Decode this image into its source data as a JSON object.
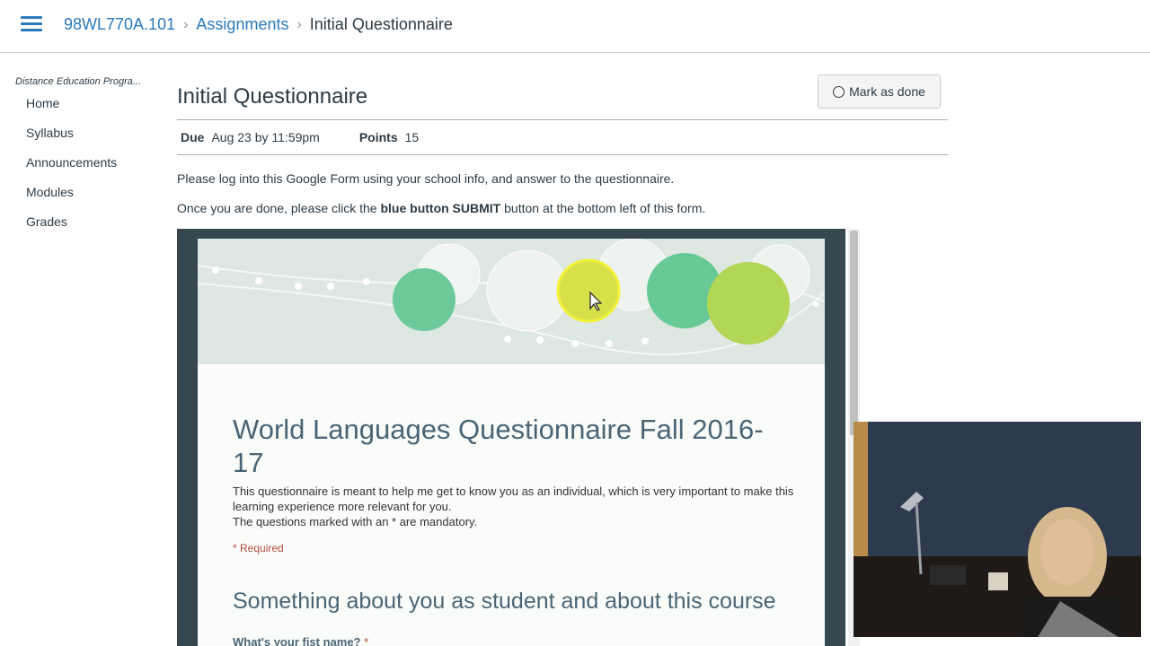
{
  "header": {
    "breadcrumbs": [
      "98WL770A.101",
      "Assignments",
      "Initial Questionnaire"
    ]
  },
  "sidebar": {
    "subtitle": "Distance Education Progra...",
    "items": [
      "Home",
      "Syllabus",
      "Announcements",
      "Modules",
      "Grades"
    ]
  },
  "assignment": {
    "title": "Initial Questionnaire",
    "mark_done_label": "Mark as done",
    "due_label": "Due",
    "due_value": "Aug 23 by 11:59pm",
    "points_label": "Points",
    "points_value": "15",
    "instruction_1": "Please log into this Google Form using your school info, and answer to the questionnaire.",
    "instruction_2_pre": "Once you are done, please click the ",
    "instruction_2_bold": "blue button SUBMIT",
    "instruction_2_post": " button at the bottom left of this form."
  },
  "form": {
    "title": "World Languages Questionnaire Fall 2016-17",
    "description_1": "This questionnaire is meant to help me get to know you as an individual, which is very important to make this learning experience more relevant for you.",
    "description_2": "The questions marked with an * are mandatory.",
    "required_note": "* Required",
    "section_title": "Something about you as student and about this course",
    "question_1": "What's your fist name?",
    "question_1_star": "*"
  },
  "colors": {
    "link": "#2b7abc",
    "text": "#2d3b45",
    "form_heading": "#4a6575",
    "required": "#b54a3a"
  },
  "icons": [
    "hamburger-menu-icon",
    "circle-icon",
    "cursor-icon"
  ]
}
